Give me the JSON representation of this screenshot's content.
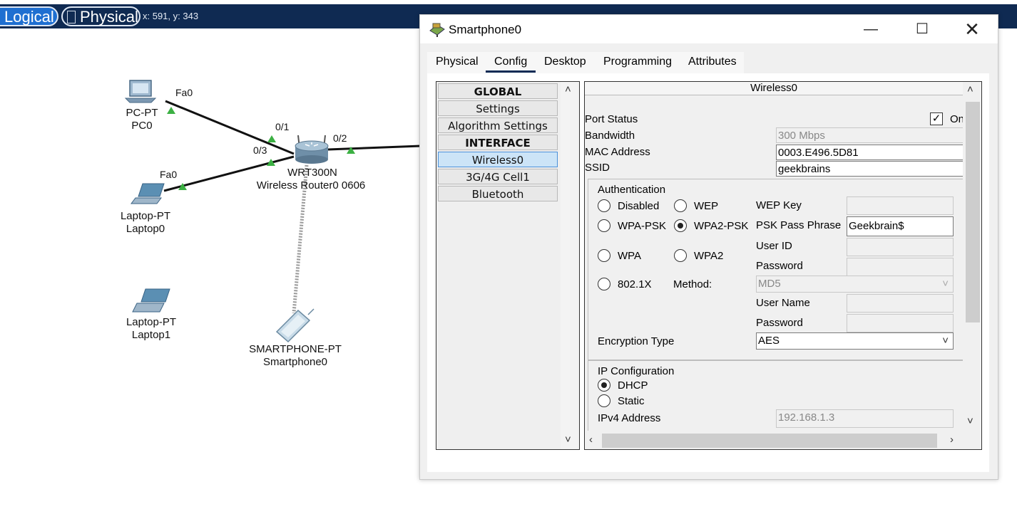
{
  "topbar": {
    "logical_label": "Logical",
    "physical_label": "Physical",
    "coords": "x: 591, y: 343"
  },
  "topology": {
    "pc0": {
      "type": "PC-PT",
      "name": "PC0",
      "port": "Fa0"
    },
    "laptop0": {
      "type": "Laptop-PT",
      "name": "Laptop0",
      "port": "Fa0"
    },
    "laptop1": {
      "type": "Laptop-PT",
      "name": "Laptop1"
    },
    "router": {
      "type": "WRT300N",
      "name": "Wireless Router0 0606",
      "ports": [
        "0/1",
        "0/3",
        "0/2"
      ]
    },
    "smartphone": {
      "type": "SMARTPHONE-PT",
      "name": "Smartphone0"
    }
  },
  "window": {
    "title": "Smartphone0",
    "tabs": [
      "Physical",
      "Config",
      "Desktop",
      "Programming",
      "Attributes"
    ],
    "active_tab": "Config",
    "sidebar": {
      "items": [
        {
          "label": "GLOBAL",
          "header": true
        },
        {
          "label": "Settings"
        },
        {
          "label": "Algorithm Settings"
        },
        {
          "label": "INTERFACE",
          "header": true
        },
        {
          "label": "Wireless0",
          "selected": true
        },
        {
          "label": "3G/4G Cell1"
        },
        {
          "label": "Bluetooth"
        }
      ]
    },
    "wireless": {
      "title": "Wireless0",
      "port_status_label": "Port Status",
      "port_status_on_label": "On",
      "port_status_on": true,
      "bandwidth_label": "Bandwidth",
      "bandwidth": "300 Mbps",
      "mac_label": "MAC Address",
      "mac": "0003.E496.5D81",
      "ssid_label": "SSID",
      "ssid": "geekbrains",
      "auth": {
        "title": "Authentication",
        "options": [
          "Disabled",
          "WEP",
          "WPA-PSK",
          "WPA2-PSK",
          "WPA",
          "WPA2",
          "802.1X"
        ],
        "selected": "WPA2-PSK",
        "wep_key_label": "WEP Key",
        "psk_label": "PSK Pass Phrase",
        "psk_value": "Geekbrain$",
        "user_id_label": "User ID",
        "password_label": "Password",
        "method_label": "Method:",
        "method_value": "MD5",
        "user_name_label": "User Name",
        "password2_label": "Password",
        "encryption_label": "Encryption Type",
        "encryption_value": "AES"
      },
      "ip": {
        "title": "IP Configuration",
        "dhcp_label": "DHCP",
        "static_label": "Static",
        "mode": "DHCP",
        "ipv4_label": "IPv4 Address",
        "ipv4_value": "192.168.1.3"
      }
    }
  },
  "colors": {
    "topbar": "#0f2a52",
    "logical_active": "#1f6fd1",
    "link_green": "#3cb043",
    "selection": "#cce4f7"
  }
}
